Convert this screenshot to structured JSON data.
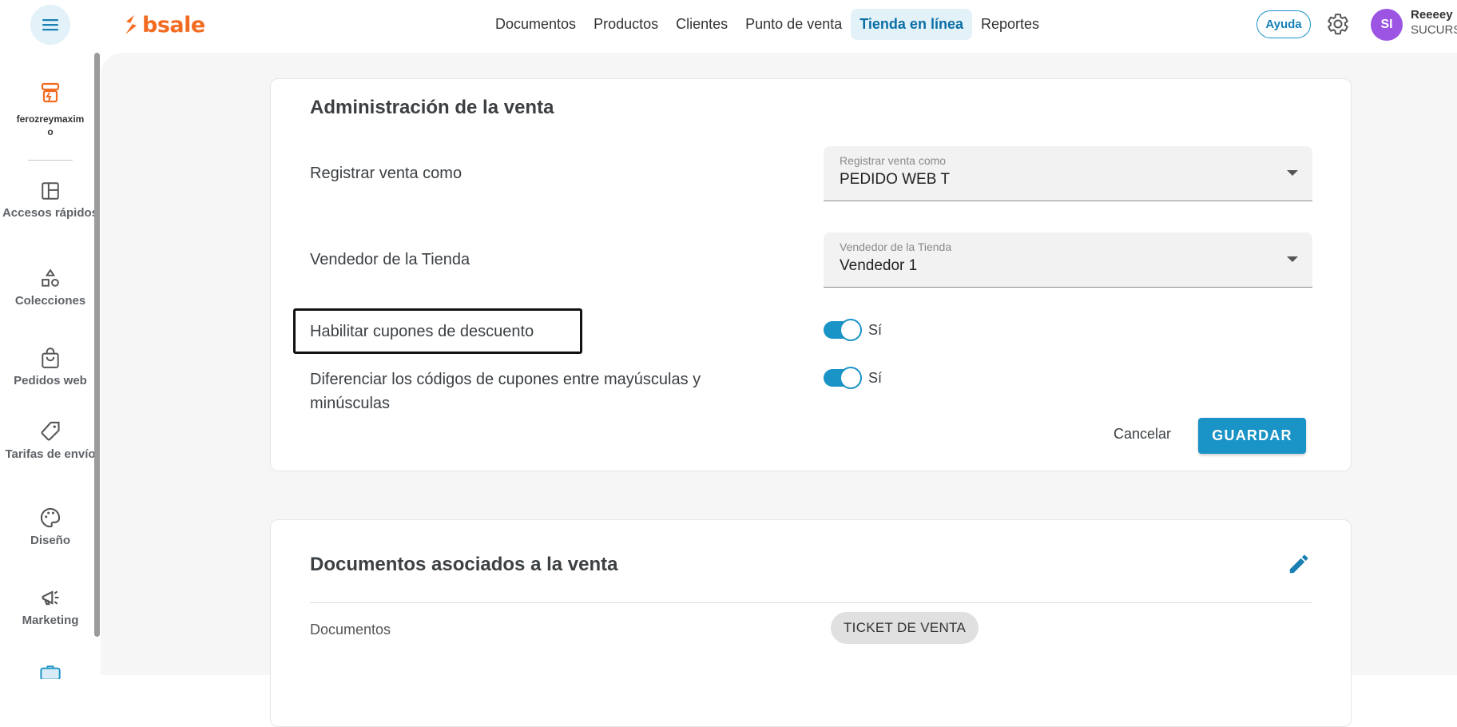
{
  "brand": {
    "name": "bsale",
    "color": "#f26b21"
  },
  "nav": {
    "items": [
      {
        "label": "Documentos",
        "active": false
      },
      {
        "label": "Productos",
        "active": false
      },
      {
        "label": "Clientes",
        "active": false
      },
      {
        "label": "Punto de venta",
        "active": false
      },
      {
        "label": "Tienda en línea",
        "active": true
      },
      {
        "label": "Reportes",
        "active": false
      }
    ]
  },
  "header": {
    "help_label": "Ayuda",
    "avatar_initials": "SI",
    "user_name": "Reeeey",
    "user_branch": "SUCURS"
  },
  "sidebar": {
    "store_name": "ferozreymaximo",
    "items": [
      {
        "label": "Accesos rápidos",
        "icon": "dashboard-icon"
      },
      {
        "label": "Colecciones",
        "icon": "shapes-icon"
      },
      {
        "label": "Pedidos web",
        "icon": "shopping-bag-icon"
      },
      {
        "label": "Tarifas de envío",
        "icon": "tag-icon"
      },
      {
        "label": "Diseño",
        "icon": "palette-icon"
      },
      {
        "label": "Marketing",
        "icon": "megaphone-icon"
      }
    ]
  },
  "sale_admin": {
    "title": "Administración de la venta",
    "register_label": "Registrar venta como",
    "register_select": {
      "caption": "Registrar venta como",
      "value": "PEDIDO WEB T"
    },
    "seller_label": "Vendedor de la Tienda",
    "seller_select": {
      "caption": "Vendedor de la Tienda",
      "value": "Vendedor 1"
    },
    "coupons_label": "Habilitar cupones de descuento",
    "coupons_toggle": "Sí",
    "case_label": "Diferenciar los códigos de cupones entre mayúsculas y minúsculas",
    "case_toggle": "Sí",
    "cancel_label": "Cancelar",
    "save_label": "GUARDAR"
  },
  "documents": {
    "title": "Documentos asociados a la venta",
    "row_label": "Documentos",
    "chip": "TICKET DE VENTA"
  },
  "colors": {
    "accent": "#1a93c7",
    "highlight": "#e3f1f8",
    "avatar": "#9c55e3"
  }
}
